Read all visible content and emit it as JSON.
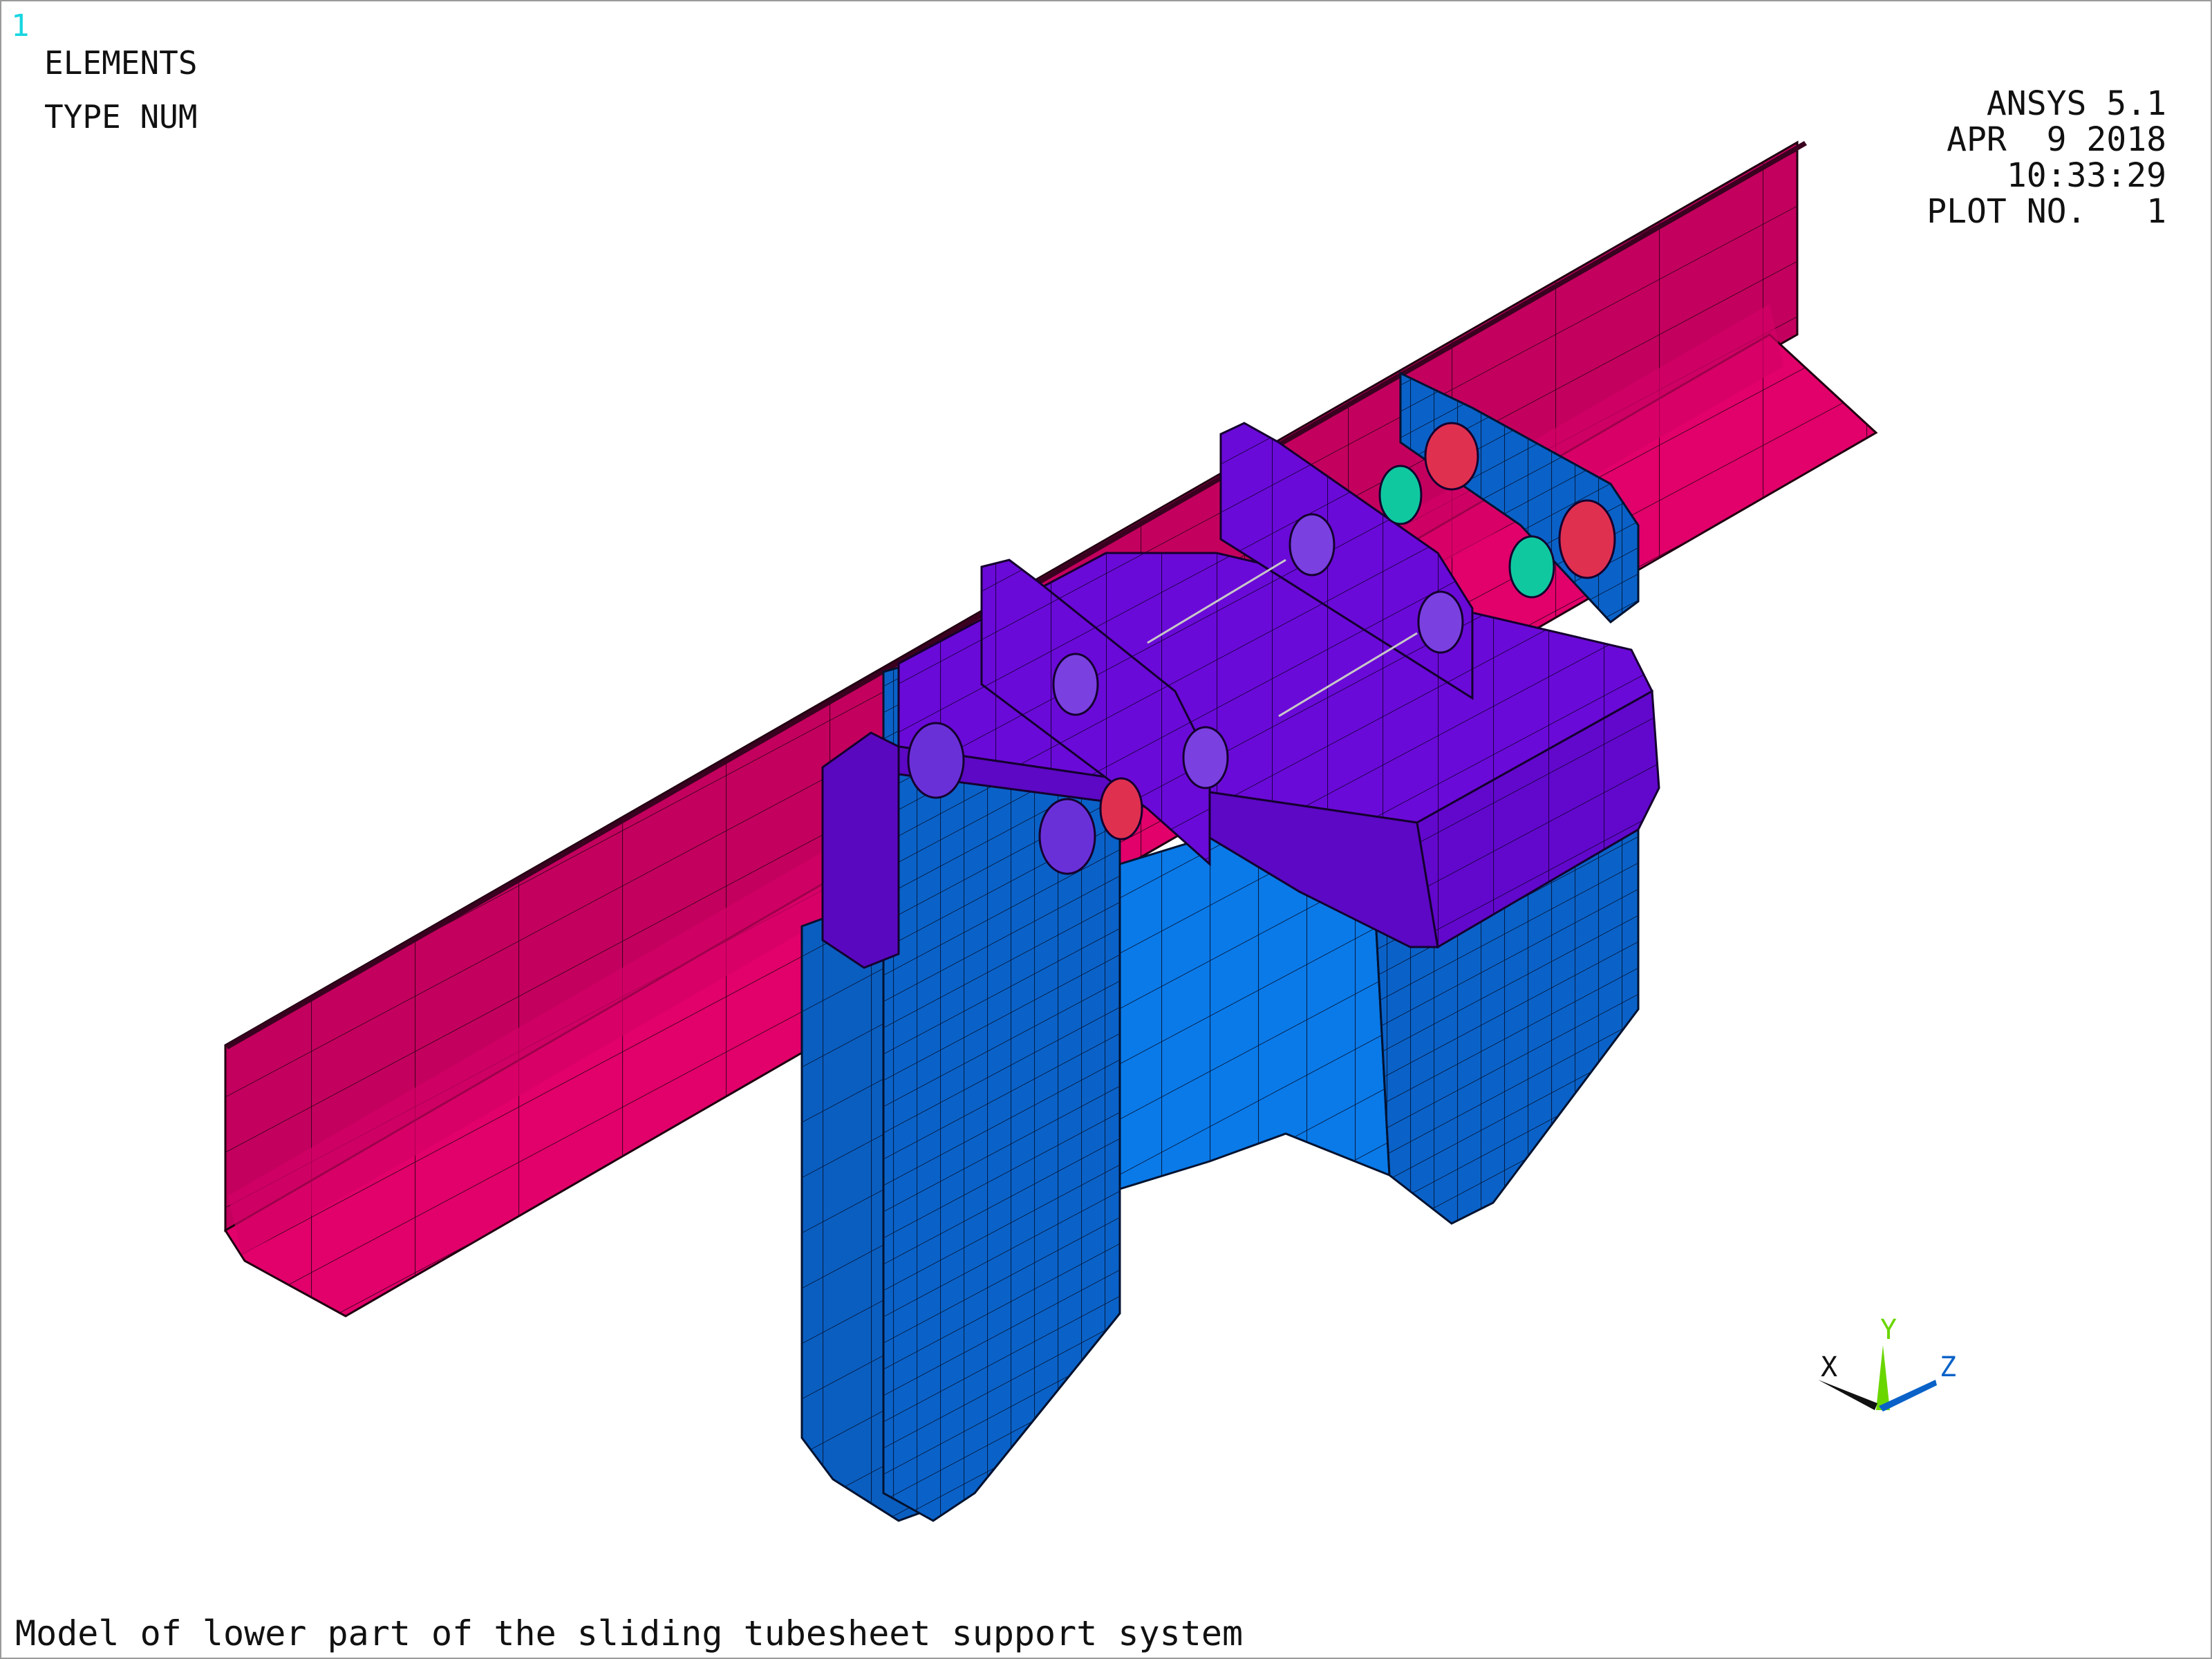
{
  "window_number": "1",
  "plot_labels": [
    "ELEMENTS",
    "TYPE NUM"
  ],
  "program": "ANSYS 5.1",
  "date": "APR  9 2018",
  "time": "10:33:29",
  "plot_no": "PLOT NO.   1",
  "caption": "Model of lower part of the sliding tubesheet support system",
  "triad": {
    "x": "X",
    "y": "Y",
    "z": "Z"
  },
  "colors": {
    "beam": "#c4005e",
    "beam_light": "#e2006a",
    "base": "#0862c8",
    "base_light": "#0a7ae8",
    "bracket": "#6a0ad8",
    "bolt_teal": "#10c8a0",
    "bolt_red": "#e03050"
  }
}
